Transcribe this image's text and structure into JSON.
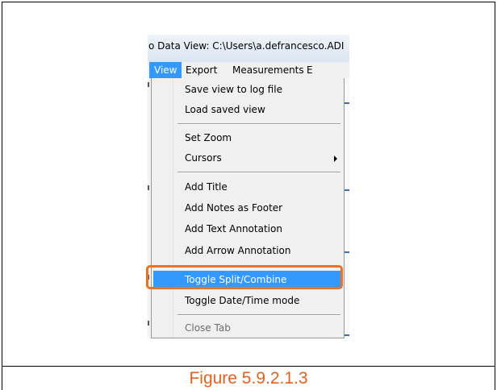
{
  "window": {
    "title": "o Data View: C:\\Users\\a.defrancesco.ADI"
  },
  "menubar": {
    "items": [
      {
        "label": "View",
        "active": true
      },
      {
        "label": "Export",
        "active": false
      },
      {
        "label": "Measurements",
        "active": false
      },
      {
        "label": "E",
        "active": false
      }
    ]
  },
  "view_menu": {
    "items": [
      {
        "label": "Save view to log file"
      },
      {
        "label": "Load saved view"
      },
      {
        "label": "Set Zoom"
      },
      {
        "label": "Cursors",
        "has_submenu": true
      },
      {
        "label": "Add Title"
      },
      {
        "label": "Add Notes as Footer"
      },
      {
        "label": "Add Text Annotation"
      },
      {
        "label": "Add Arrow Annotation"
      },
      {
        "label": "Toggle Split/Combine",
        "highlighted": true
      },
      {
        "label": "Toggle Date/Time mode"
      },
      {
        "label": "Close Tab",
        "disabled": true
      }
    ]
  },
  "caption": {
    "text": "Figure 5.9.2.1.3"
  },
  "colors": {
    "highlight": "#3399ff",
    "callout": "#f07022",
    "caption": "#e8601c"
  }
}
